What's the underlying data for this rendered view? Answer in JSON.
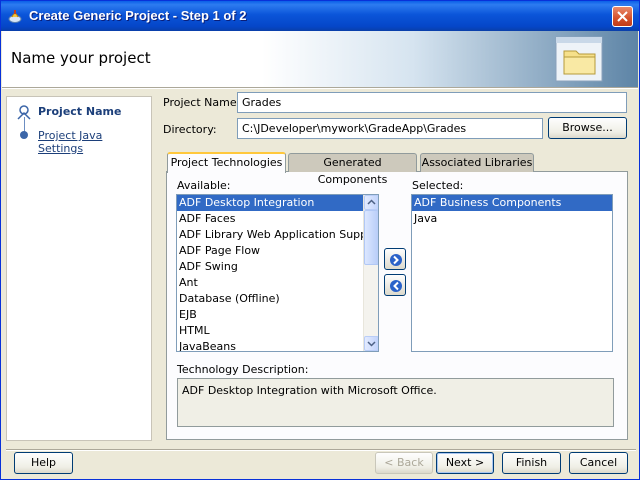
{
  "window": {
    "title": "Create Generic Project - Step 1 of 2"
  },
  "header": {
    "title": "Name your project",
    "art_icon": "folder-icon"
  },
  "steps": [
    {
      "label": "Project Name",
      "active": true
    },
    {
      "label": "Project Java Settings",
      "active": false
    }
  ],
  "form": {
    "project_name_label": "Project Name:",
    "project_name_value": "Grades",
    "directory_label": "Directory:",
    "directory_value": "C:\\JDeveloper\\mywork\\GradeApp\\Grades",
    "browse_label": "Browse..."
  },
  "tabs": [
    {
      "label": "Project Technologies",
      "active": true
    },
    {
      "label": "Generated Components",
      "active": false
    },
    {
      "label": "Associated Libraries",
      "active": false
    }
  ],
  "technologies": {
    "available_label": "Available:",
    "available": [
      "ADF Desktop Integration",
      "ADF Faces",
      "ADF Library Web Application Support",
      "ADF Page Flow",
      "ADF Swing",
      "Ant",
      "Database (Offline)",
      "EJB",
      "HTML",
      "JavaBeans"
    ],
    "available_selected_index": 0,
    "selected_label": "Selected:",
    "selected": [
      "ADF Business Components",
      "Java"
    ],
    "selected_selected_index": 0,
    "description_label": "Technology Description:",
    "description": "ADF Desktop Integration with Microsoft Office."
  },
  "buttons": {
    "help": "Help",
    "back": "< Back",
    "next": "Next >",
    "finish": "Finish",
    "cancel": "Cancel"
  },
  "colors": {
    "titlebar": "#0b55d9",
    "selection": "#316ac5",
    "dialog_bg": "#ece9d8"
  }
}
